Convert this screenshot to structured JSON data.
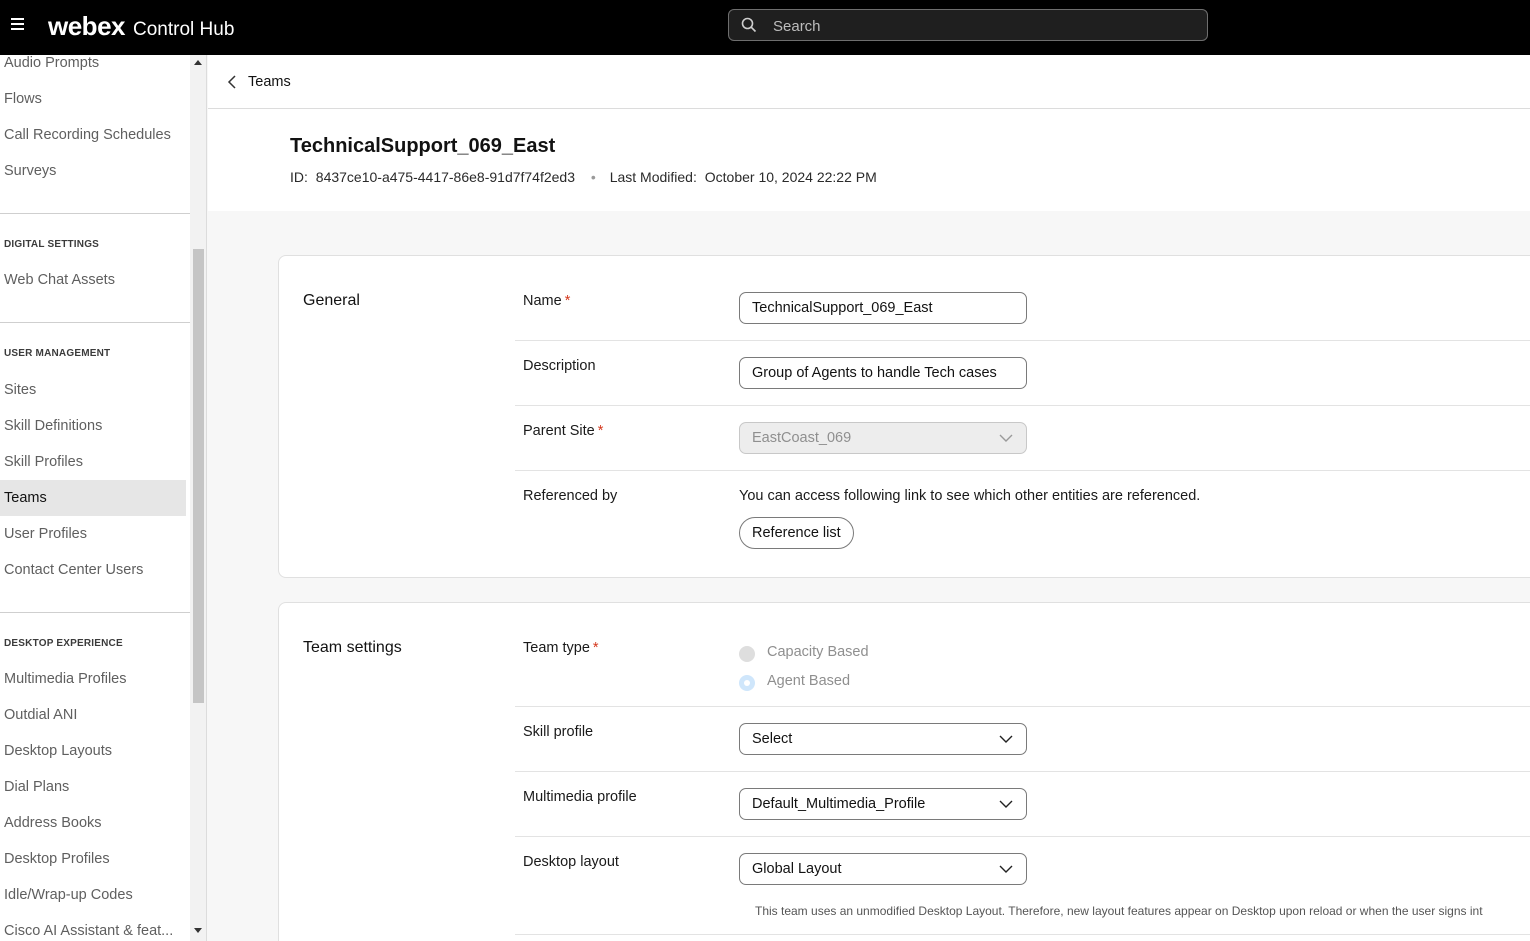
{
  "topbar": {
    "brand": "webex",
    "product": "Control Hub",
    "search_placeholder": "Search"
  },
  "sidebar": {
    "items_top": [
      "Audio Prompts",
      "Flows",
      "Call Recording Schedules",
      "Surveys"
    ],
    "digital_settings": {
      "heading": "DIGITAL SETTINGS",
      "items": [
        "Web Chat Assets"
      ]
    },
    "user_management": {
      "heading": "USER MANAGEMENT",
      "items": [
        "Sites",
        "Skill Definitions",
        "Skill Profiles",
        "Teams",
        "User Profiles",
        "Contact Center Users"
      ],
      "active": "Teams"
    },
    "desktop_experience": {
      "heading": "DESKTOP EXPERIENCE",
      "items": [
        "Multimedia Profiles",
        "Outdial ANI",
        "Desktop Layouts",
        "Dial Plans",
        "Address Books",
        "Desktop Profiles",
        "Idle/Wrap-up Codes",
        "Cisco AI Assistant & feat..."
      ]
    }
  },
  "breadcrumb": {
    "label": "Teams"
  },
  "header": {
    "title": "TechnicalSupport_069_East",
    "id_label": "ID:",
    "id_value": "8437ce10-a475-4417-86e8-91d7f74f2ed3",
    "modified_label": "Last Modified:",
    "modified_value": "October 10, 2024 22:22 PM"
  },
  "general": {
    "title": "General",
    "name_label": "Name",
    "name_value": "TechnicalSupport_069_East",
    "description_label": "Description",
    "description_value": "Group of Agents to handle Tech cases",
    "parent_site_label": "Parent Site",
    "parent_site_value": "EastCoast_069",
    "referenced_label": "Referenced by",
    "referenced_text": "You can access following link to see which other entities are referenced.",
    "reference_button": "Reference list"
  },
  "team_settings": {
    "title": "Team settings",
    "team_type_label": "Team type",
    "team_type_options": [
      "Capacity Based",
      "Agent Based"
    ],
    "team_type_selected": "Agent Based",
    "skill_profile_label": "Skill profile",
    "skill_profile_value": "Select",
    "multimedia_profile_label": "Multimedia profile",
    "multimedia_profile_value": "Default_Multimedia_Profile",
    "desktop_layout_label": "Desktop layout",
    "desktop_layout_value": "Global Layout",
    "desktop_layout_note": "This team uses an unmodified Desktop Layout. Therefore, new layout features appear on Desktop upon reload or when the user signs int"
  },
  "required_marker": "*",
  "colors": {
    "topbar": "#000000",
    "required": "#d4371c",
    "active_item": "#e6e6e6",
    "radio_selected": "#cfe6fb"
  }
}
